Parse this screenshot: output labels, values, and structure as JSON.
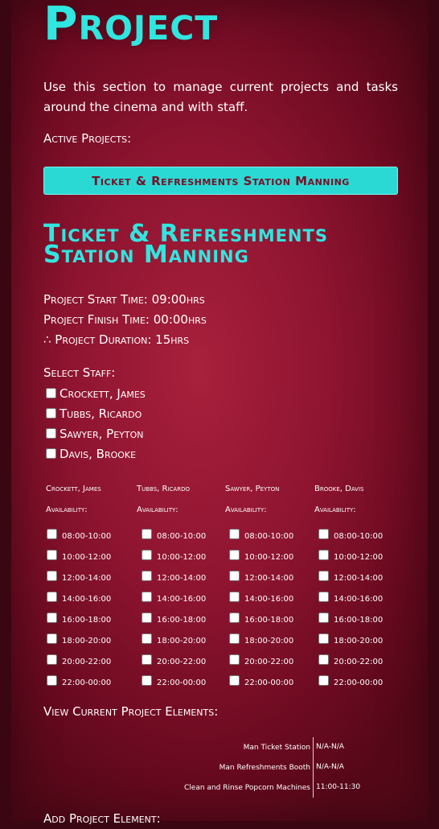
{
  "page": {
    "title": "Project",
    "intro": "Use this section to manage current projects and tasks around the cinema and with staff.",
    "active_projects_label": "Active Projects:",
    "active_project_button": "Ticket & Refreshments Station Manning"
  },
  "project": {
    "title_line1": "Ticket & Refreshments",
    "title_line2": "Station Manning",
    "start_time": "Project Start Time: 09:00hrs",
    "finish_time": "Project Finish Time: 00:00hrs",
    "duration": "∴ Project Duration: 15hrs",
    "select_staff_label": "Select Staff:",
    "staff": [
      "Crockett, James",
      "Tubbs, Ricardo",
      "Sawyer, Peyton",
      "Davis, Brooke"
    ]
  },
  "availability": {
    "label": "Availability:",
    "columns": [
      {
        "name": "Crockett, James"
      },
      {
        "name": "Tubbs, Ricardo"
      },
      {
        "name": "Sawyer, Peyton"
      },
      {
        "name": "Brooke, Davis"
      }
    ],
    "slots": [
      "08:00-10:00",
      "10:00-12:00",
      "12:00-14:00",
      "14:00-16:00",
      "16:00-18:00",
      "18:00-20:00",
      "20:00-22:00",
      "22:00-00:00"
    ]
  },
  "elements": {
    "label": "View Current Project Elements:",
    "rows": [
      {
        "name": "Man Ticket Station",
        "time": "N/A-N/A"
      },
      {
        "name": "Man Refreshments Booth",
        "time": "N/A-N/A"
      },
      {
        "name": "Clean and Rinse Popcorn Machines",
        "time": "11:00-11:30"
      }
    ],
    "add_label": "Add Project Element:"
  },
  "colors": {
    "accent": "#30e6e0",
    "button_bg": "#2ad9d4",
    "button_text": "#7a0f26",
    "background": "#8e1430"
  }
}
